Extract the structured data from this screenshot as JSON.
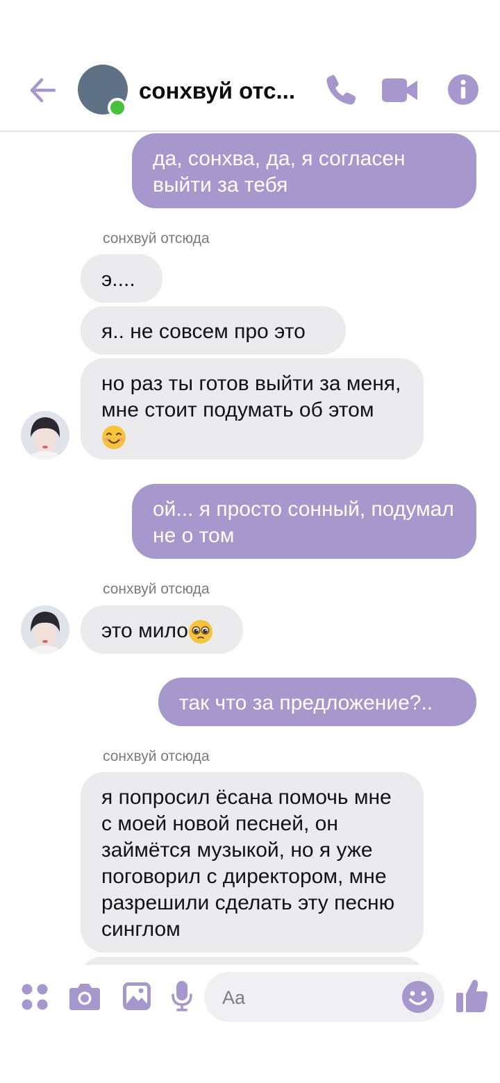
{
  "header": {
    "title": "сонхвуй отс...",
    "icons": {
      "back": "arrow-left-icon",
      "call": "phone-icon",
      "video": "video-camera-icon",
      "info": "info-icon"
    },
    "accent_color": "#a698cc",
    "online_color": "#46c13a"
  },
  "messages": {
    "m1": {
      "direction": "outgoing",
      "text": "да, сонхва, да, я согласен выйти за тебя"
    },
    "s1": {
      "sender": "сонхвуй отсюда"
    },
    "m2": {
      "direction": "incoming",
      "text": "э...."
    },
    "m3": {
      "direction": "incoming",
      "text": "я.. не совсем про это"
    },
    "m4": {
      "direction": "incoming",
      "text": "но раз ты готов выйти за меня, мне стоит подумать об этом",
      "emoji": "smiling-face-icon"
    },
    "m5": {
      "direction": "outgoing",
      "text": "ой... я просто сонный, подумал не о том"
    },
    "s2": {
      "sender": "сонхвуй отсюда"
    },
    "m6": {
      "direction": "incoming",
      "text": "это мило",
      "emoji": "pleading-face-icon"
    },
    "m7": {
      "direction": "outgoing",
      "text": "так что за предложение?.."
    },
    "s3": {
      "sender": "сонхвуй отсюда"
    },
    "m8": {
      "direction": "incoming",
      "text": "я попросил ёсана помочь мне с моей новой песней, он займётся музыкой, но я уже поговорил с директором, мне разрешили сделать эту песню синглом"
    }
  },
  "composer": {
    "placeholder": "Aa",
    "icons": [
      "apps-icon",
      "camera-icon",
      "image-icon",
      "microphone-icon",
      "emoji-icon",
      "thumbs-up-icon"
    ]
  },
  "colors": {
    "outgoing_bubble": "#a698cc",
    "incoming_bubble": "#ebebee"
  }
}
